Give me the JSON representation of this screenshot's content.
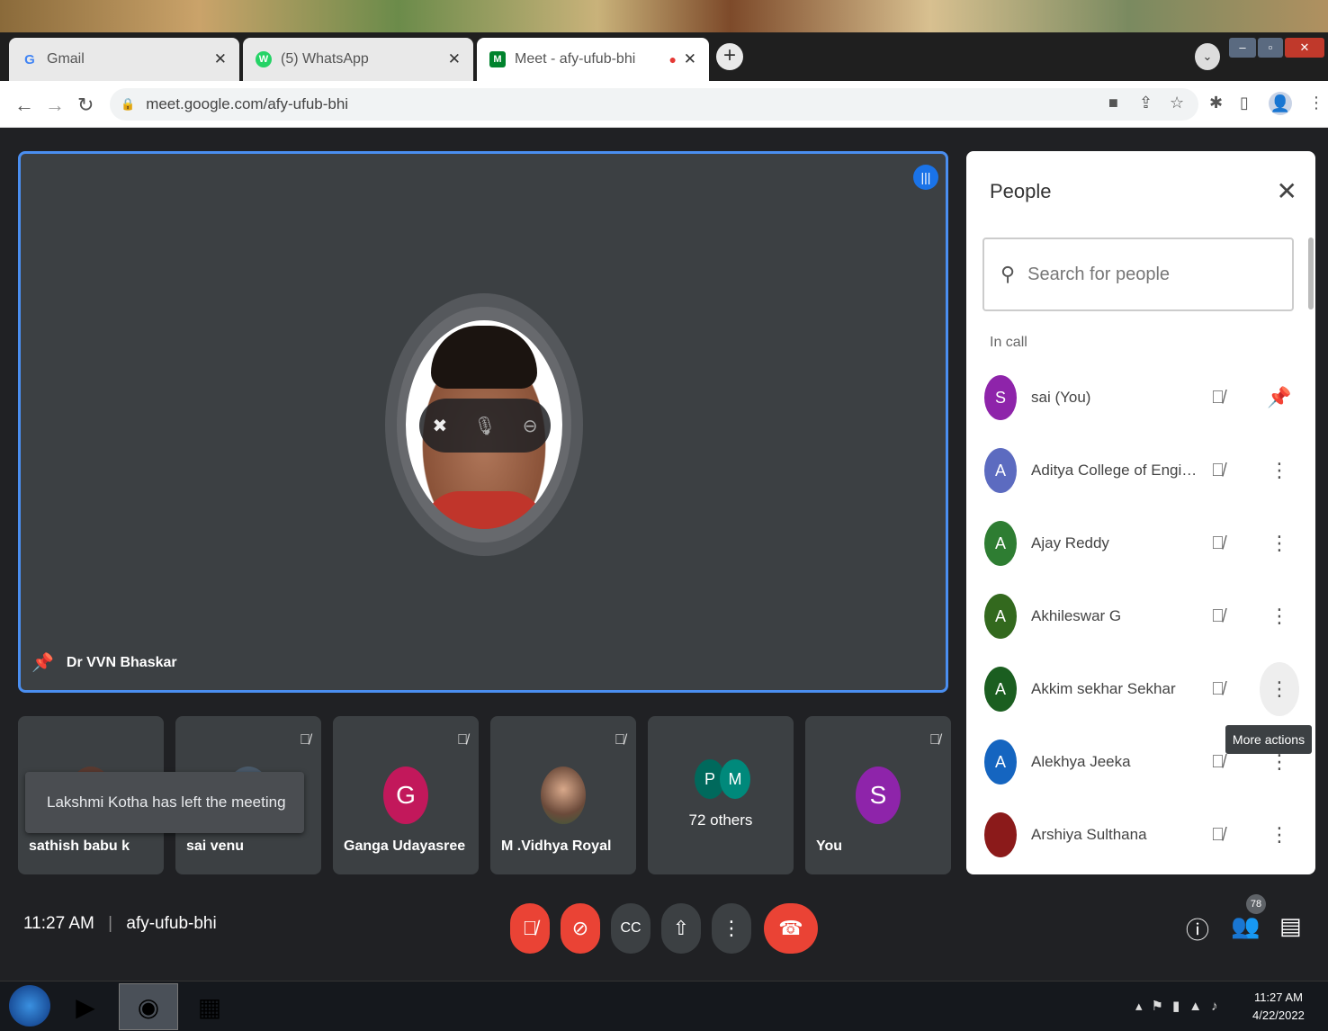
{
  "browser": {
    "tabs": [
      {
        "title": "Gmail",
        "icon": "G"
      },
      {
        "title": "(5) WhatsApp",
        "icon": "W"
      },
      {
        "title": "Meet - afy-ufub-bhi",
        "icon": "M"
      }
    ],
    "url": "meet.google.com/afy-ufub-bhi"
  },
  "stage": {
    "name": "Dr VVN Bhaskar"
  },
  "tiles": [
    {
      "name": "sathish babu k"
    },
    {
      "name": "sai venu"
    },
    {
      "name": "Ganga Udayasree",
      "initial": "G",
      "color": "#c2185b"
    },
    {
      "name": "M .Vidhya Royal"
    },
    {
      "others": "72 others",
      "initials": [
        "P",
        "M"
      ],
      "colors": [
        "#00695c",
        "#00897b"
      ]
    },
    {
      "name": "You",
      "initial": "S",
      "color": "#8e24aa"
    }
  ],
  "toast": "Lakshmi Kotha has left the meeting",
  "people": {
    "title": "People",
    "search_placeholder": "Search for people",
    "section": "In call",
    "tooltip": "More actions",
    "members": [
      {
        "name": "sai (You)",
        "initial": "S",
        "color": "#8e24aa"
      },
      {
        "name": "Aditya College of Enginee...",
        "initial": "A",
        "color": "#5c6bc0"
      },
      {
        "name": "Ajay Reddy",
        "initial": "A",
        "color": "#2e7d32"
      },
      {
        "name": "Akhileswar G",
        "initial": "A",
        "color": "#33691e"
      },
      {
        "name": "Akkim sekhar Sekhar",
        "initial": "A",
        "color": "#1b5e20"
      },
      {
        "name": "Alekhya Jeeka",
        "initial": "A",
        "color": "#1565c0"
      },
      {
        "name": "Arshiya Sulthana",
        "initial": "",
        "color": "#8b1a1a"
      }
    ]
  },
  "meeting": {
    "time": "11:27 AM",
    "code": "afy-ufub-bhi",
    "participant_count": "78"
  },
  "taskbar": {
    "time": "11:27 AM",
    "date": "4/22/2022"
  }
}
